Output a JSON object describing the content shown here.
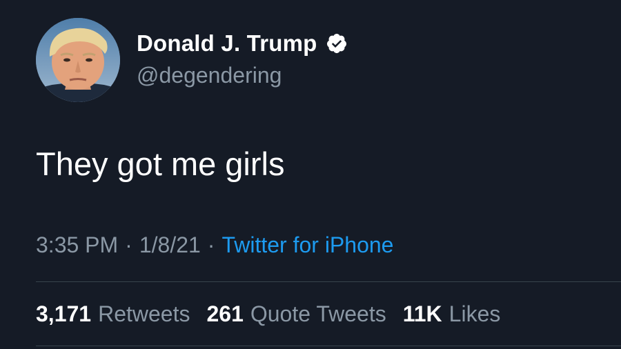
{
  "tweet": {
    "author": {
      "display_name": "Donald J. Trump",
      "handle": "@degendering",
      "verified": true,
      "verified_icon": "verified-badge-icon",
      "avatar": "profile-photo"
    },
    "text": "They got me girls",
    "meta": {
      "time": "3:35 PM",
      "separator": "·",
      "date": "1/8/21",
      "source": "Twitter for iPhone"
    },
    "stats": [
      {
        "count": "3,171",
        "label": "Retweets"
      },
      {
        "count": "261",
        "label": "Quote Tweets"
      },
      {
        "count": "11K",
        "label": "Likes"
      }
    ]
  },
  "colors": {
    "background": "#151b26",
    "primary_text": "#ffffff",
    "secondary_text": "#8b98a5",
    "link": "#1d9bf0",
    "divider": "#38444d"
  }
}
